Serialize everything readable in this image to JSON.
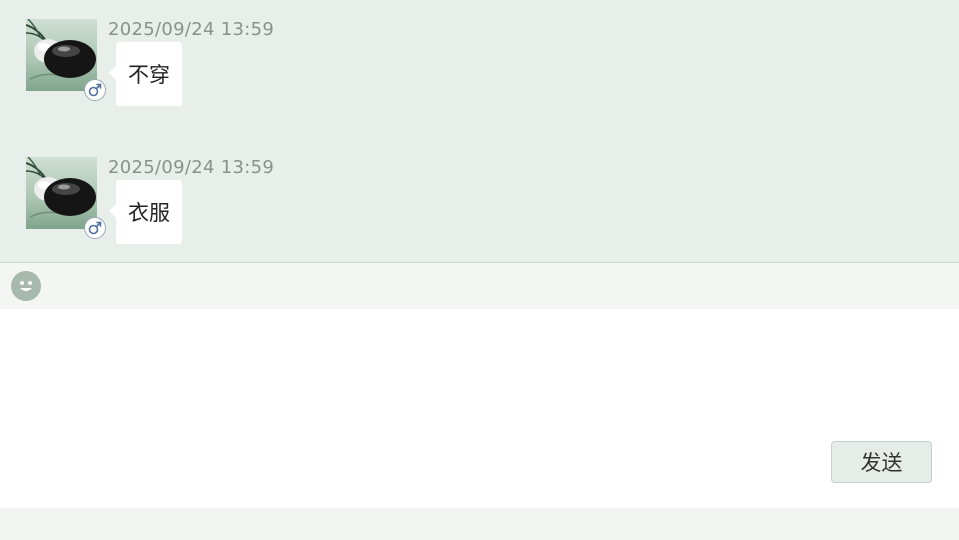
{
  "chat": {
    "messages": [
      {
        "timestamp": "2025/09/24 13:59",
        "text": "不穿",
        "avatar_icon": "go-stone-avatar-icon",
        "gender_icon": "male-icon"
      },
      {
        "timestamp": "2025/09/24 13:59",
        "text": "衣服",
        "avatar_icon": "go-stone-avatar-icon",
        "gender_icon": "male-icon"
      }
    ]
  },
  "toolbar": {
    "emoji_icon": "emoji-smile-icon"
  },
  "composer": {
    "value": "",
    "placeholder": "",
    "send_label": "发送"
  },
  "colors": {
    "chat_background": "#e8eeea",
    "bubble_background": "#ffffff",
    "timestamp_text": "#8a918c",
    "emoji_icon": "#a7b8ac",
    "send_button_background": "#e6ede8",
    "gender_badge_border": "#9aa7b8",
    "gender_symbol": "#4e6fa0"
  }
}
